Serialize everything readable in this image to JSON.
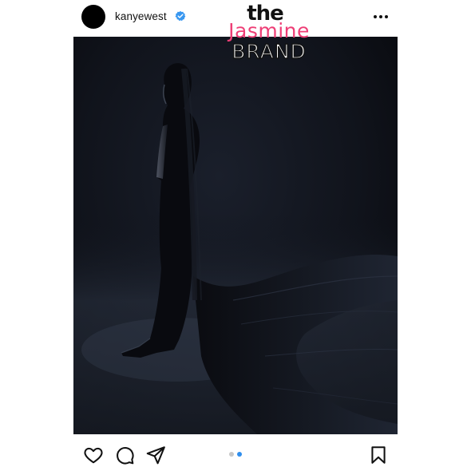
{
  "post": {
    "username": "kanyewest",
    "verified": true,
    "image_description": "Dark studio photo of a figure in a fully covered black gown with a long train",
    "carousel": {
      "count": 2,
      "active_index": 2
    }
  },
  "watermark": {
    "line1": "the",
    "line2": "Jasmine",
    "line3": "BRAND"
  },
  "icons": {
    "avatar": "avatar",
    "verified": "verified-badge-icon",
    "more": "more-options-icon",
    "like": "heart-icon",
    "comment": "comment-icon",
    "share": "send-icon",
    "save": "bookmark-icon"
  },
  "colors": {
    "verified_blue": "#3897f0",
    "carousel_active": "#2f8eed",
    "carousel_inactive": "#c7c7c7",
    "watermark_pink": "#ee3e76"
  }
}
